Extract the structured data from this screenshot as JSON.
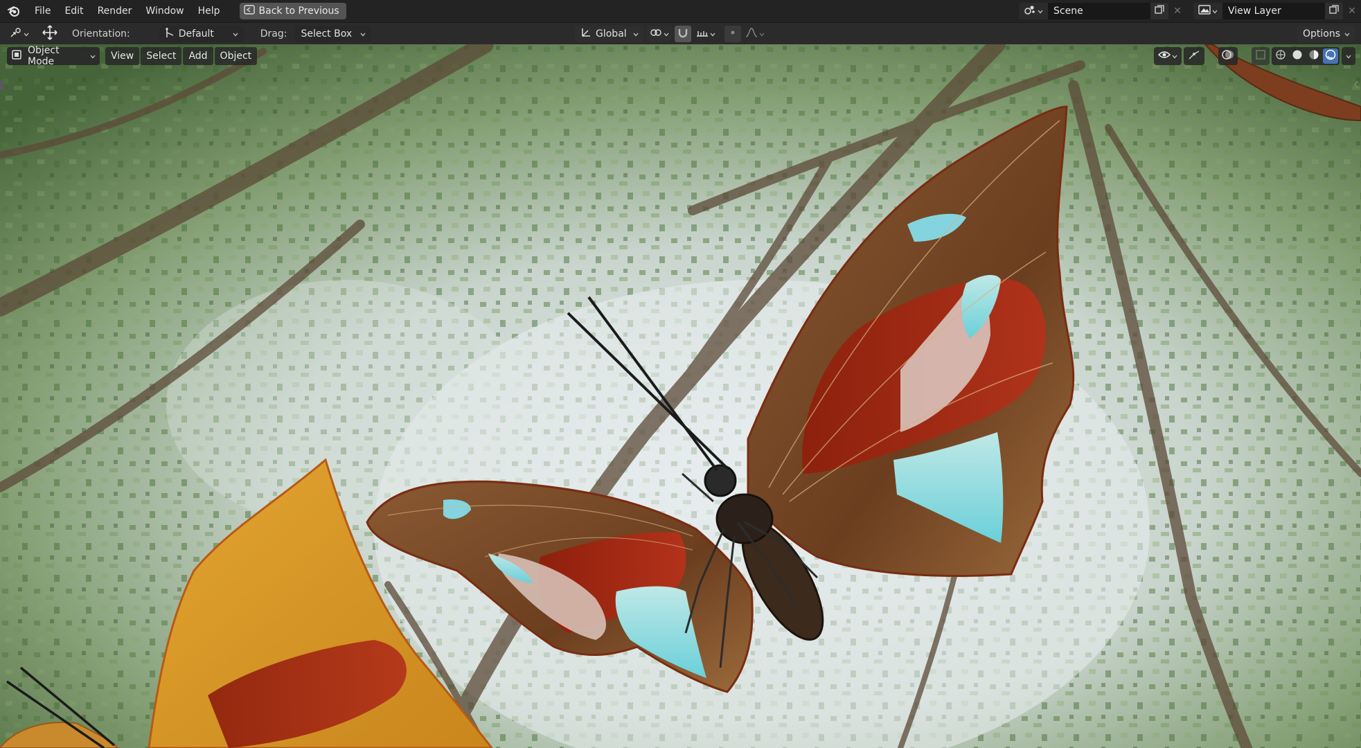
{
  "menubar": {
    "items": [
      {
        "id": "file",
        "label": "File"
      },
      {
        "id": "edit",
        "label": "Edit"
      },
      {
        "id": "render",
        "label": "Render"
      },
      {
        "id": "window",
        "label": "Window"
      },
      {
        "id": "help",
        "label": "Help"
      }
    ],
    "back_button": "Back to Previous",
    "scene_name": "Scene",
    "view_layer_name": "View Layer"
  },
  "toolbar": {
    "orientation_label": "Orientation:",
    "orientation_value": "Default",
    "drag_label": "Drag:",
    "drag_value": "Select Box",
    "transform_orientation": "Global",
    "options_label": "Options"
  },
  "viewport": {
    "mode": "Object Mode",
    "menus": [
      "View",
      "Select",
      "Add",
      "Object"
    ],
    "active_shading": "rendered",
    "icons": [
      "visibility-icon",
      "gizmo-icon",
      "overlay-icon",
      "xray-icon",
      "wireframe-shading-icon",
      "solid-shading-icon",
      "material-shading-icon",
      "rendered-shading-icon"
    ]
  },
  "colors": {
    "accent": "#4772b3",
    "topbar": "#232323",
    "header": "#2b2b2b"
  }
}
